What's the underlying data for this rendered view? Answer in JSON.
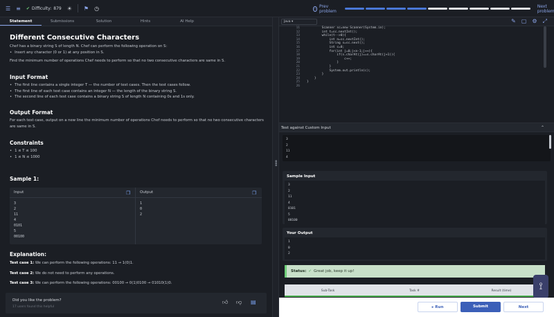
{
  "topbar": {
    "difficulty_label": "Difficulty:",
    "difficulty_value": "879",
    "prev_label": "Prev problem",
    "next_label": "Next problem",
    "progress_segments": 9,
    "progress_active": 4
  },
  "tabs": [
    "Statement",
    "Submissions",
    "Solution",
    "Hints",
    "AI Help"
  ],
  "statement": {
    "title": "Different Consecutive Characters",
    "intro": "Chef has a binary string S of length N. Chef can perform the following operation on S:",
    "op": "Insert any character (0 or 1) at any position in S.",
    "goal": "Find the minimum number of operations Chef needs to perform so that no two consecutive characters are same in S.",
    "input_h": "Input Format",
    "input_items": [
      "The first line contains a single integer T — the number of test cases. Then the test cases follow.",
      "The first line of each test case contains an integer N — the length of the binary string S.",
      "The second line of each test case contains a binary string S of length N containing 0s and 1s only."
    ],
    "output_h": "Output Format",
    "output_text": "For each test case, output on a new line the minimum number of operations Chef needs to perform so that no two consecutive characters are same in S.",
    "constraints_h": "Constraints",
    "constraints": [
      "1 ≤ T ≤ 100",
      "1 ≤ N ≤ 1000"
    ],
    "sample_h": "Sample 1:",
    "sample_input_label": "Input",
    "sample_output_label": "Output",
    "sample_input": [
      "3",
      "2",
      "11",
      "4",
      "0101",
      "5",
      "00100"
    ],
    "sample_output": [
      "1",
      "0",
      "2"
    ],
    "explanation_h": "Explanation:",
    "tc1_label": "Test case 1:",
    "tc1_text": "We can perform the following operations: 11 → 1(0)1.",
    "tc2_label": "Test case 2:",
    "tc2_text": "We do not need to perform any operations.",
    "tc3_label": "Test case 3:",
    "tc3_text": "We can perform the following operations: 00100 → 0(1)0100 → 01010(1)0."
  },
  "feedback": {
    "question": "Did you like the problem?",
    "sub": "17 users found this helpful"
  },
  "editor": {
    "language": "Java",
    "line_numbers": [
      "11",
      "12",
      "13",
      "14",
      "15",
      "16",
      "17",
      "18",
      "19",
      "20",
      "21",
      "22",
      "23",
      "24",
      "25",
      "26"
    ],
    "code_lines": [
      "        Scanner sc=new Scanner(System.in);",
      "        int t=sc.nextInt();",
      "        while(t-->0){",
      "            int n=sc.nextInt();",
      "            String s=sc.next();",
      "            int c=0;",
      "            for(int j=0;j<n-1;j++){",
      "                if(s.charAt(j)==s.charAt(j+1)){",
      "                    c++;",
      "                }",
      "            }",
      "            System.out.println(c);",
      "        }",
      "    }",
      "}",
      ""
    ]
  },
  "custom_input": {
    "label": "Test against Custom Input",
    "values": [
      "3",
      "2",
      "11",
      "4"
    ]
  },
  "sample_input_box": {
    "title": "Sample Input",
    "values": [
      "3",
      "2",
      "11",
      "4",
      "0101",
      "5",
      "00100"
    ]
  },
  "your_output_box": {
    "title": "Your Output",
    "values": [
      "1",
      "0",
      "2"
    ]
  },
  "status": {
    "label": "Status:",
    "message": "Great job, keep it up!"
  },
  "result_table": {
    "headers": [
      "Sub-Task",
      "Task #",
      "Result (time)"
    ]
  },
  "buttons": {
    "run": "▸ Run",
    "submit": "Submit",
    "next": "Next"
  },
  "colors": {
    "accent": "#3b5fb8",
    "success": "#6fcf7a",
    "bg": "#1b1e24"
  }
}
